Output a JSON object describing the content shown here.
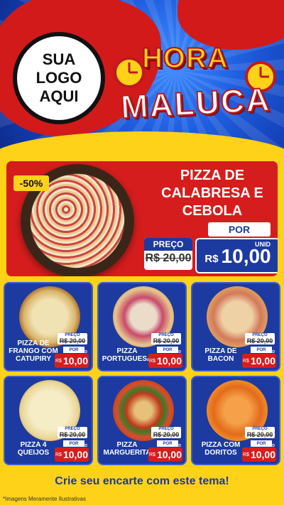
{
  "header": {
    "logo_lines": [
      "SUA",
      "LOGO",
      "AQUI"
    ],
    "title_line1": "HORA",
    "title_line2": "MALUCA"
  },
  "hero": {
    "discount": "-50%",
    "title": "PIZZA DE CALABRESA E CEBOLA",
    "preco_label": "PREÇO",
    "old_price": "R$ 20,00",
    "por_label": "POR",
    "currency": "R$",
    "price": "10,00",
    "unit": "UNID"
  },
  "products": [
    {
      "name": "PIZZA DE FRANGO COM CATUPIRY",
      "preco_label": "PREÇO",
      "old_price": "R$ 20,00",
      "por_label": "POR",
      "currency": "R$",
      "price": "10,00",
      "unit": "UNID"
    },
    {
      "name": "PIZZA PORTUGUESA",
      "preco_label": "PREÇO",
      "old_price": "R$ 20,00",
      "por_label": "POR",
      "currency": "R$",
      "price": "10,00",
      "unit": "UNID"
    },
    {
      "name": "PIZZA DE BACON",
      "preco_label": "PREÇO",
      "old_price": "R$ 20,00",
      "por_label": "POR",
      "currency": "R$",
      "price": "10,00",
      "unit": "UNID"
    },
    {
      "name": "PIZZA 4 QUEIJOS",
      "preco_label": "PREÇO",
      "old_price": "R$ 20,00",
      "por_label": "POR",
      "currency": "R$",
      "price": "10,00",
      "unit": "UNID"
    },
    {
      "name": "PIZZA MARGUERITA",
      "preco_label": "PREÇO",
      "old_price": "R$ 20,00",
      "por_label": "POR",
      "currency": "R$",
      "price": "10,00",
      "unit": "UNID"
    },
    {
      "name": "PIZZA COM DORITOS",
      "preco_label": "PREÇO",
      "old_price": "R$ 20,00",
      "por_label": "POR",
      "currency": "R$",
      "price": "10,00",
      "unit": "UNID"
    }
  ],
  "cta": "Crie seu encarte com este tema!",
  "disclaimer": "*Imagens Meramente Ilustrativas",
  "colors": {
    "red": "#d61d1d",
    "blue": "#1d3aa0",
    "yellow": "#ffd21a"
  }
}
